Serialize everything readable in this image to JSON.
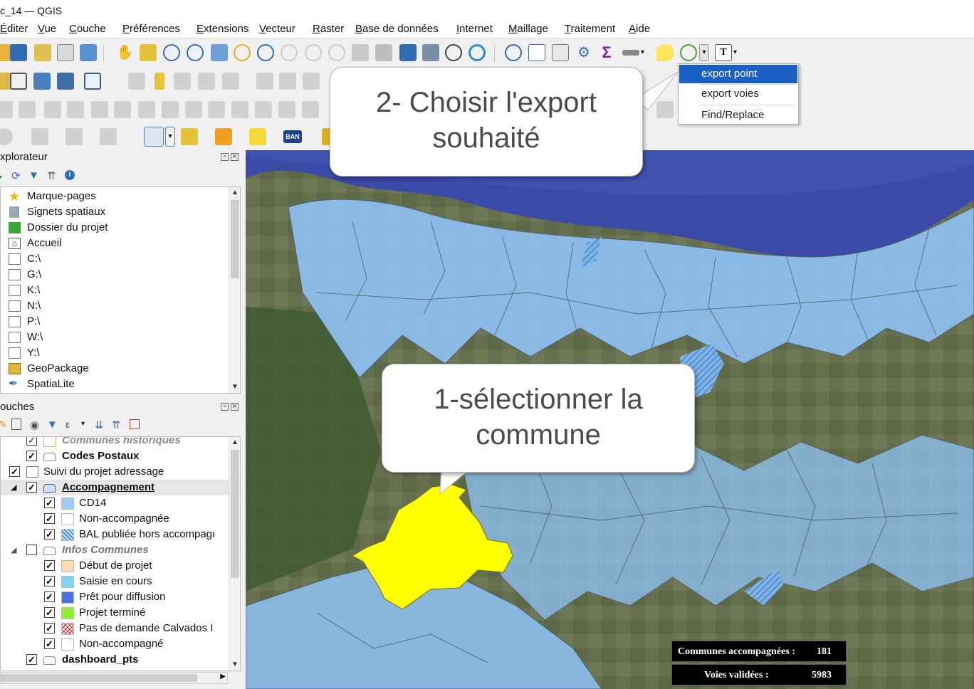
{
  "window": {
    "title": "c_14 — QGIS"
  },
  "menu": [
    "Éditer",
    "Vue",
    "Couche",
    "Préférences",
    "Extensions",
    "Vecteur",
    "Raster",
    "Base de données",
    "Internet",
    "Maillage",
    "Traitement",
    "Aide"
  ],
  "dropdown": {
    "items": [
      "export point",
      "export voies",
      "Find/Replace"
    ],
    "active": "export point"
  },
  "toolbar": {
    "ban_label": "BAN"
  },
  "explorer": {
    "title": "xplorateur",
    "items": [
      "Marque-pages",
      "Signets spatiaux",
      "Dossier du projet",
      "Accueil",
      "C:\\",
      "G:\\",
      "K:\\",
      "N:\\",
      "P:\\",
      "W:\\",
      "Y:\\",
      "GeoPackage",
      "SpatiaLite"
    ]
  },
  "layers": {
    "title": "ouches",
    "rows": [
      {
        "label": "Communes historiques",
        "style": "italic-gray"
      },
      {
        "label": "Codes Postaux",
        "style": "bold"
      },
      {
        "label": "Suivi du projet adressage",
        "style": "normal"
      },
      {
        "label": "Accompagnement",
        "style": "bold-underline"
      },
      {
        "label": "CD14",
        "style": "normal"
      },
      {
        "label": "Non-accompagnée",
        "style": "normal"
      },
      {
        "label": "BAL publiée hors accompagı",
        "style": "normal"
      },
      {
        "label": "Infos Communes",
        "style": "italic-gray"
      },
      {
        "label": "Début de projet",
        "style": "normal"
      },
      {
        "label": "Saisie en cours",
        "style": "normal"
      },
      {
        "label": "Prêt pour diffusion",
        "style": "normal"
      },
      {
        "label": "Projet terminé",
        "style": "normal"
      },
      {
        "label": "Pas de demande Calvados I",
        "style": "normal"
      },
      {
        "label": "Non-accompagné",
        "style": "normal"
      },
      {
        "label": "dashboard_pts",
        "style": "bold"
      }
    ]
  },
  "callouts": {
    "step2": "2- Choisir l'export souhaité",
    "step1": "1-sélectionner la commune"
  },
  "stats": {
    "communes_label": "Communes accompagnées :",
    "communes_value": "181",
    "voies_label": "Voies validées :",
    "voies_value": "5983"
  },
  "colors": {
    "selection": "#ffff00",
    "communes_fill": "#8fc3f5",
    "sea": "#3d4ba8",
    "dropdown_active": "#1a5fc4"
  }
}
